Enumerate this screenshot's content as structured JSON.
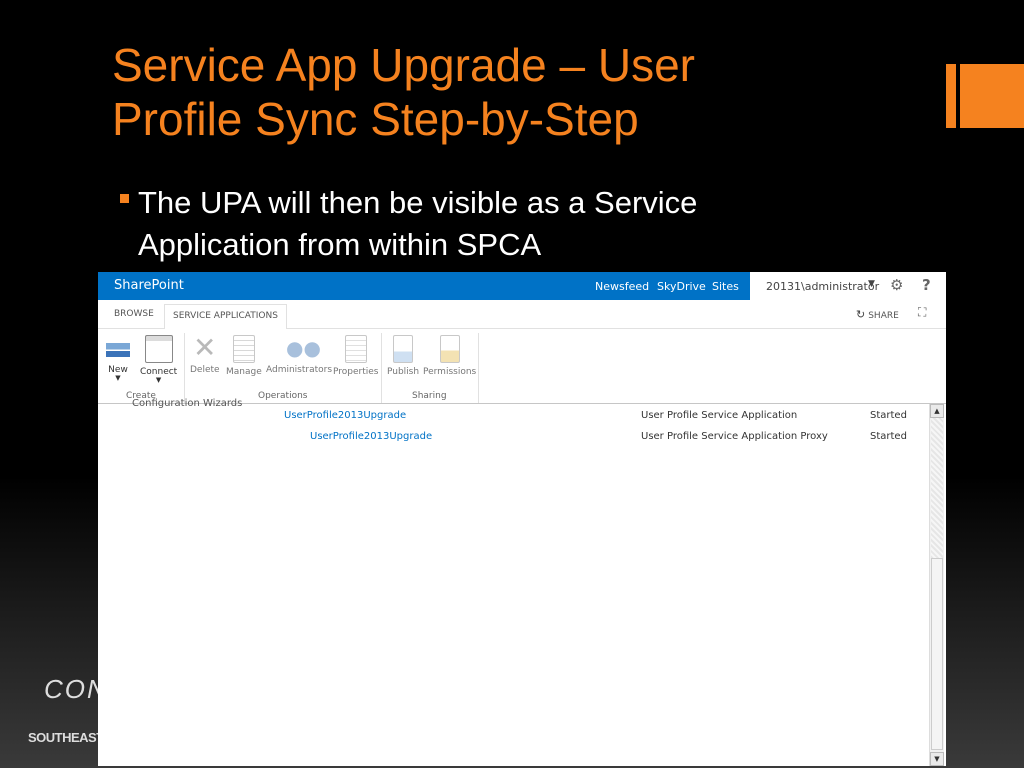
{
  "slide": {
    "title_line1": "Service App Upgrade – User",
    "title_line2": "Profile Sync Step-by-Step",
    "bullet": "The UPA will then be visible as a Service Application from within SPCA",
    "footer_logo": "CON",
    "footer_sub": "SOUTHEAST"
  },
  "colors": {
    "accent": "#f5821f",
    "suitebar": "#0072c6",
    "link": "#0072c6"
  },
  "suitebar": {
    "brand": "SharePoint",
    "nav": [
      "Newsfeed",
      "SkyDrive",
      "Sites"
    ],
    "user": "20131\\administrator",
    "gear_icon": "gear-icon",
    "help": "?"
  },
  "tabs": {
    "browse": "BROWSE",
    "service_applications": "SERVICE APPLICATIONS",
    "share": "SHARE"
  },
  "ribbon": {
    "create": {
      "label": "Create",
      "new": "New",
      "connect": "Connect"
    },
    "operations": {
      "label": "Operations",
      "delete": "Delete",
      "manage": "Manage",
      "administrators": "Administrators",
      "properties": "Properties"
    },
    "sharing": {
      "label": "Sharing",
      "publish": "Publish",
      "permissions": "Permissions"
    }
  },
  "content": {
    "partial_heading": "Configuration Wizards",
    "rows": [
      {
        "name": "UserProfile2013Upgrade",
        "type": "User Profile Service Application",
        "status": "Started"
      },
      {
        "name": "UserProfile2013Upgrade",
        "type": "User Profile Service Application Proxy",
        "status": "Started"
      }
    ]
  }
}
